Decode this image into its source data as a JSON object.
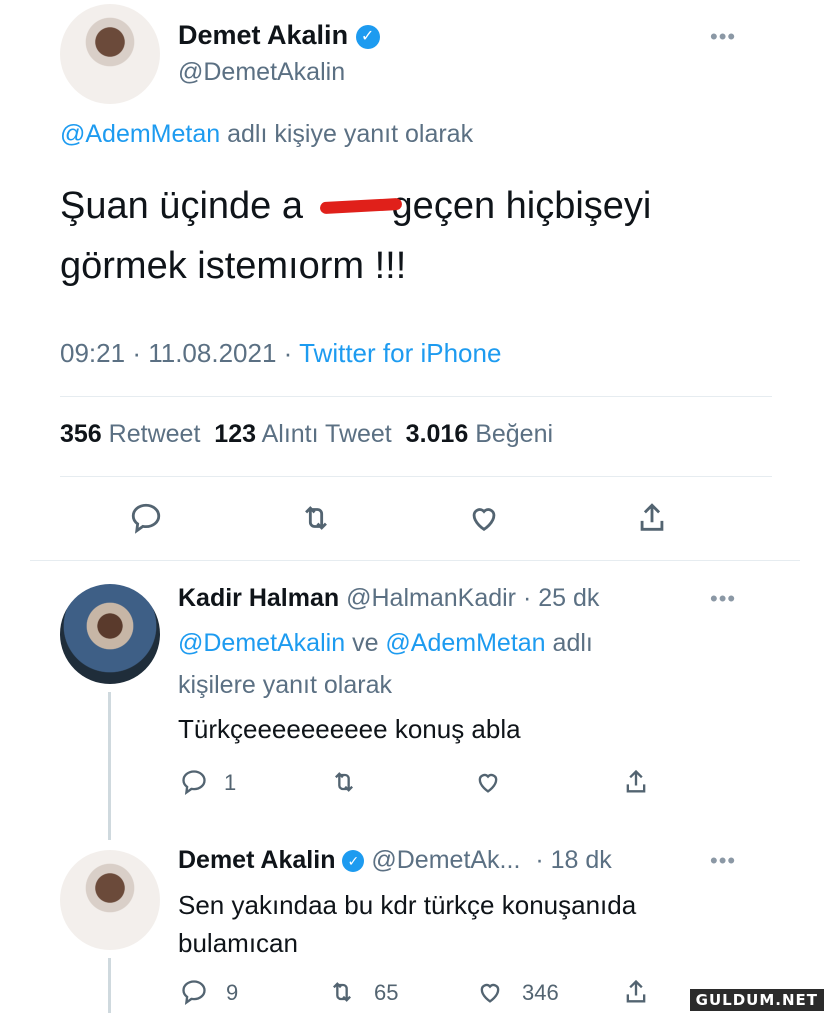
{
  "main_tweet": {
    "author_name": "Demet Akalin",
    "handle": "@DemetAkalin",
    "reply_to_user": "@AdemMetan",
    "reply_to_suffix": "adlı kişiye yanıt olarak",
    "text_line1_a": "Şuan üçinde a",
    "text_line1_b": "geçen hiçbişeyi",
    "text_line2": "görmek istemıorm !!!",
    "time": "09:21",
    "date": "11.08.2021",
    "source": "Twitter for iPhone",
    "separator": "·",
    "retweet_count": "356",
    "retweet_label": "Retweet",
    "quote_count": "123",
    "quote_label": "Alıntı Tweet",
    "like_count": "3.016",
    "like_label": "Beğeni"
  },
  "reply1": {
    "author_name": "Kadir Halman",
    "handle": "@HalmanKadir",
    "time": "· 25 dk",
    "reply_to_user1": "@DemetAkalin",
    "reply_to_and": "ve",
    "reply_to_user2": "@AdemMetan",
    "reply_to_suffix1": "adlı",
    "reply_to_suffix2": "kişilere yanıt olarak",
    "text": "Türkçeeeeeeeeee konuş abla",
    "reply_count": "1"
  },
  "reply2": {
    "author_name": "Demet Akalin",
    "handle": "@DemetAk...",
    "time": "· 18 dk",
    "text_line1": "Sen yakındaa bu kdr türkçe konuşanıda",
    "text_line2": "bulamıcan",
    "reply_count": "9",
    "retweet_count": "65",
    "like_count": "346"
  },
  "watermark": "GULDUM.NET",
  "colors": {
    "link": "#1d9bf0",
    "muted": "#5b7083",
    "redaction": "#e0201a"
  }
}
